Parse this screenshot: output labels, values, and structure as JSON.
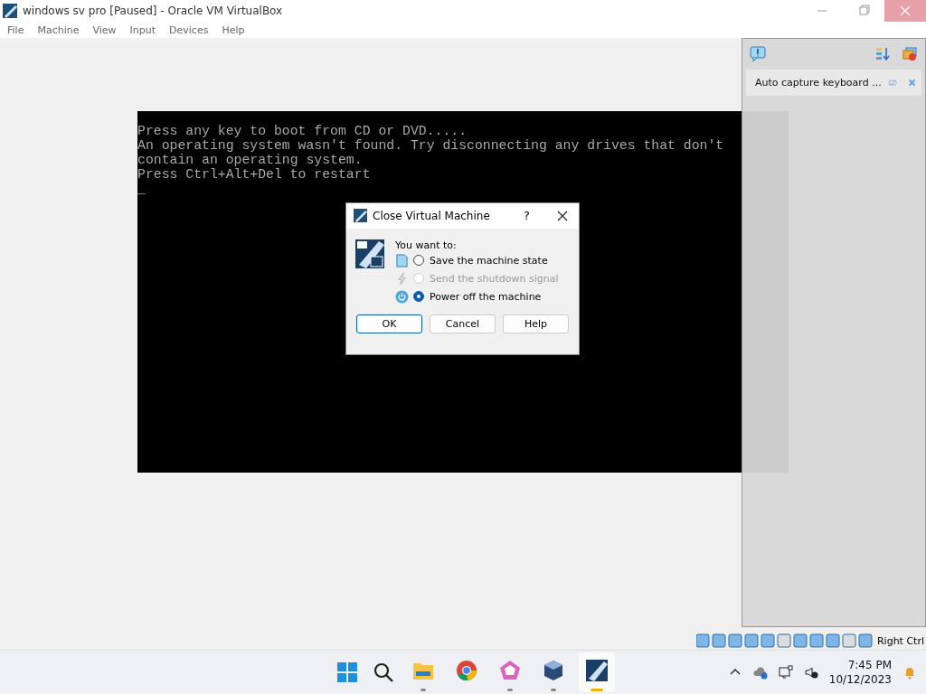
{
  "window": {
    "title": "windows  sv pro [Paused] - Oracle VM VirtualBox"
  },
  "menu": [
    "File",
    "Machine",
    "View",
    "Input",
    "Devices",
    "Help"
  ],
  "console": {
    "lines": [
      "Press any key to boot from CD or DVD.....",
      "An operating system wasn't found. Try disconnecting any drives that don't",
      "contain an operating system.",
      "Press Ctrl+Alt+Del to restart",
      "_"
    ]
  },
  "notification": {
    "message": "Auto capture keyboard ..."
  },
  "dialog": {
    "title": "Close Virtual Machine",
    "help_mark": "?",
    "prompt": "You want to:",
    "options": [
      {
        "kind": "save",
        "label": "Save the machine state",
        "selected": false,
        "disabled": false
      },
      {
        "kind": "shutdown",
        "label": "Send the shutdown signal",
        "selected": false,
        "disabled": true
      },
      {
        "kind": "poweroff",
        "label": "Power off the machine",
        "selected": true,
        "disabled": false
      }
    ],
    "buttons": [
      "OK",
      "Cancel",
      "Help"
    ]
  },
  "status_bar": {
    "host_key": "Right Ctrl"
  },
  "taskbar": {
    "apps": [
      {
        "kind": "explorer",
        "running": true,
        "active": false
      },
      {
        "kind": "chrome",
        "running": false,
        "active": false
      },
      {
        "kind": "pentagon",
        "running": true,
        "active": false
      },
      {
        "kind": "virtualbox",
        "running": true,
        "active": false
      },
      {
        "kind": "vm",
        "running": true,
        "active": true
      }
    ],
    "time": "7:45 PM",
    "date": "10/12/2023"
  }
}
